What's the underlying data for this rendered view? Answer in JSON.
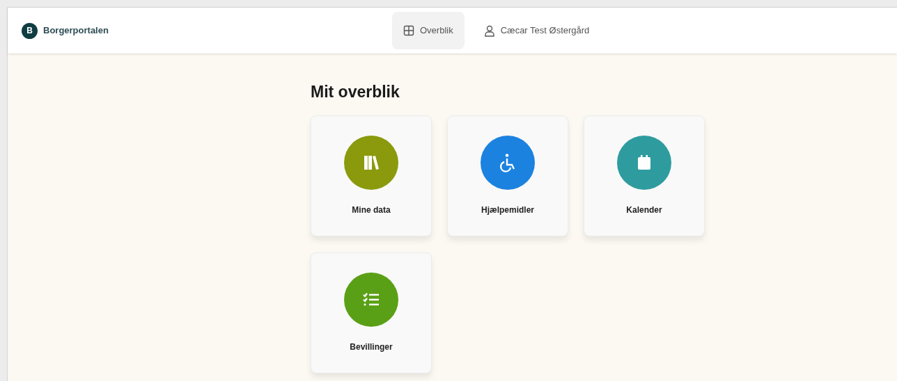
{
  "header": {
    "logo_letter": "B",
    "brand": "Borgerportalen"
  },
  "nav": [
    {
      "label": "Overblik",
      "kind": "grid",
      "selected": true
    },
    {
      "label": "Cæcar Test Østergård",
      "kind": "user",
      "selected": false
    }
  ],
  "page_title": "Mit overblik",
  "tiles": [
    {
      "label": "Mine data",
      "kind": "books",
      "color": "#8a9a0c"
    },
    {
      "label": "Hjælpemidler",
      "kind": "wheelchair",
      "color": "#1b82e0"
    },
    {
      "label": "Kalender",
      "kind": "calendar",
      "color": "#2e9c9f"
    },
    {
      "label": "Bevillinger",
      "kind": "checklist",
      "color": "#5aa016"
    }
  ]
}
